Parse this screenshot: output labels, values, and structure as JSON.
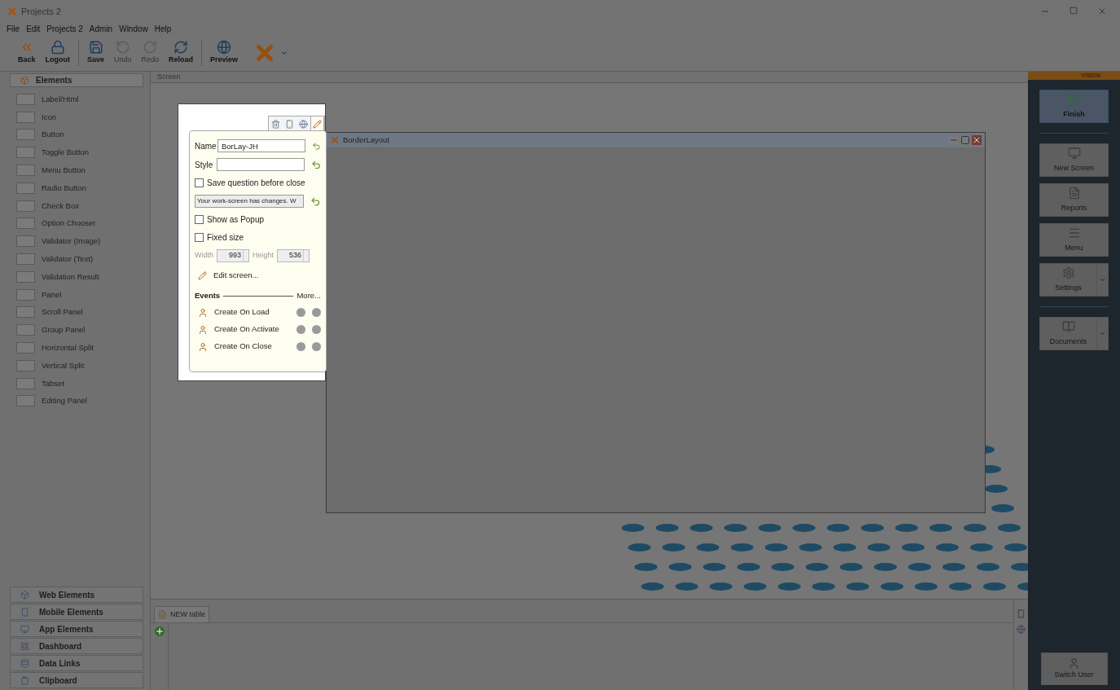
{
  "window": {
    "title": "Projects 2"
  },
  "menu": [
    "File",
    "Edit",
    "Projects 2",
    "Admin",
    "Window",
    "Help"
  ],
  "toolbar": [
    {
      "kind": "back",
      "label": "Back",
      "disabled": false
    },
    {
      "kind": "logout",
      "label": "Logout",
      "disabled": false
    },
    {
      "kind": "save",
      "label": "Save",
      "disabled": false
    },
    {
      "kind": "undo",
      "label": "Undo",
      "disabled": true
    },
    {
      "kind": "redo",
      "label": "Redo",
      "disabled": true
    },
    {
      "kind": "reload",
      "label": "Reload",
      "disabled": false
    },
    {
      "kind": "preview",
      "label": "Preview",
      "disabled": false
    }
  ],
  "elements_panel": {
    "header": "Elements",
    "items": [
      "Label/Html",
      "Icon",
      "Button",
      "Toggle Button",
      "Menu Button",
      "Radio Button",
      "Check Box",
      "Option Chooser",
      "Validator (Image)",
      "Validator (Text)",
      "Validation Result",
      "Panel",
      "Scroll Panel",
      "Group Panel",
      "Horizontal Split",
      "Vertical Split",
      "Tabset",
      "Editing Panel"
    ]
  },
  "categories": [
    "Web Elements",
    "Mobile Elements",
    "App Elements",
    "Dashboard",
    "Data Links",
    "Clipboard"
  ],
  "breadcrumb": "Screen",
  "form_window": {
    "title": "BorderLayout"
  },
  "properties_popup": {
    "tabs": [
      {
        "kind": "trash",
        "selected": false
      },
      {
        "kind": "phone",
        "selected": false
      },
      {
        "kind": "globe",
        "selected": false
      },
      {
        "kind": "pencil",
        "selected": true
      }
    ],
    "name": {
      "label": "Name",
      "value": "BorLay-JH"
    },
    "style": {
      "label": "Style"
    },
    "save_question": {
      "label": "Save question before close",
      "checked": false
    },
    "message": {
      "value": "Your work-screen has changes. W"
    },
    "show_as_popup": {
      "label": "Show as Popup",
      "checked": false
    },
    "fixed_size": {
      "label": "Fixed size",
      "checked": false
    },
    "width": {
      "label": "Width",
      "value": "993",
      "disabled": true
    },
    "height": {
      "label": "Height",
      "value": "536",
      "disabled": true
    },
    "edit_screen": "Edit screen...",
    "events_header": "Events",
    "more": "More...",
    "events": [
      "Create On Load",
      "Create On Activate",
      "Create On Close"
    ]
  },
  "right_panel": {
    "brand": "VISION",
    "buttons": [
      {
        "label": "Finish",
        "selected": true,
        "kind": "plain"
      },
      {
        "label": "New Screen",
        "selected": false,
        "kind": "plain"
      },
      {
        "label": "Reports",
        "selected": false,
        "kind": "plain"
      },
      {
        "label": "Menu",
        "selected": false,
        "kind": "plain"
      },
      {
        "label": "Settings",
        "selected": false,
        "kind": "split"
      },
      {
        "label": "Documents",
        "selected": false,
        "kind": "split"
      }
    ],
    "switch_user": "Switch User"
  },
  "bottom_panel": {
    "tab": "NEW table"
  }
}
